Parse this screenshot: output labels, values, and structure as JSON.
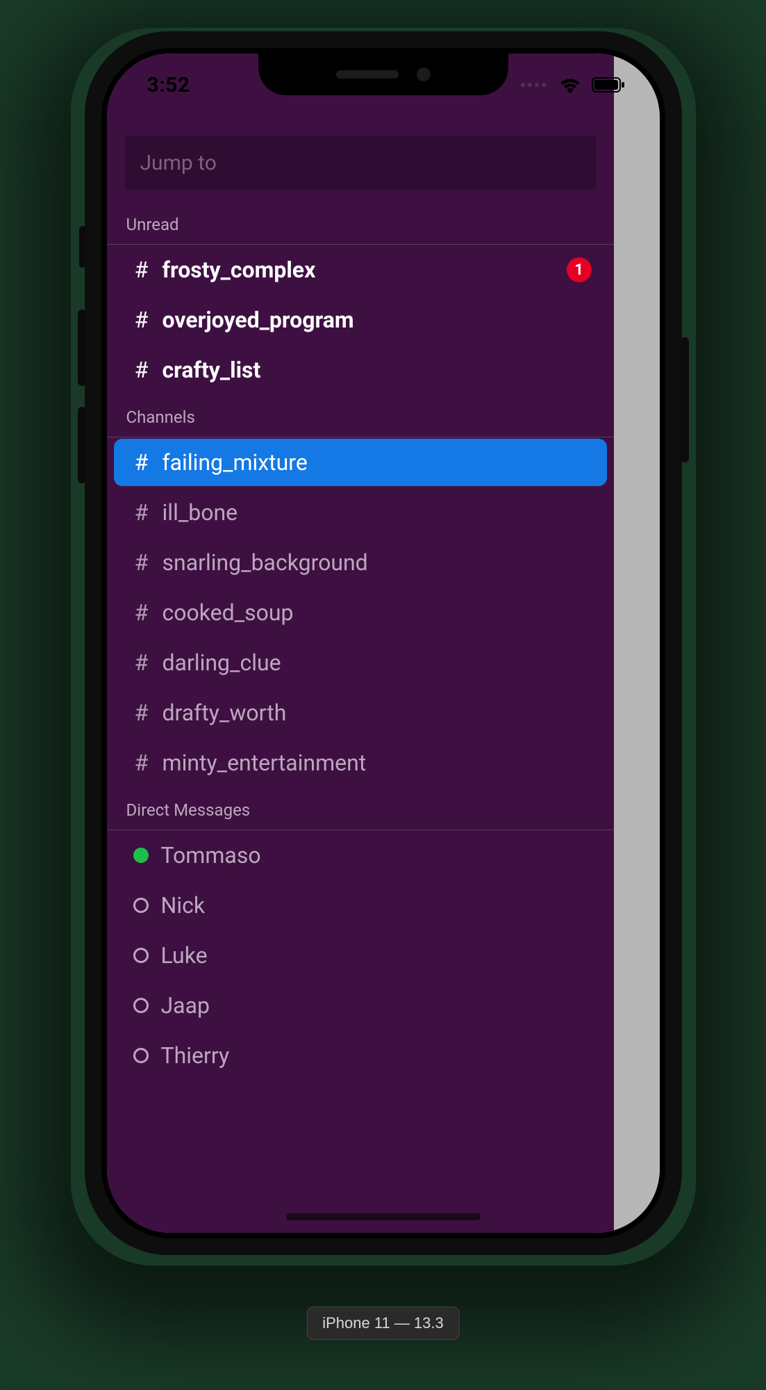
{
  "device_label": "iPhone 11 — 13.3",
  "status": {
    "time": "3:52"
  },
  "search": {
    "placeholder": "Jump to"
  },
  "sections": {
    "unread": {
      "title": "Unread",
      "items": [
        {
          "name": "frosty_complex",
          "badge": "1"
        },
        {
          "name": "overjoyed_program"
        },
        {
          "name": "crafty_list"
        }
      ]
    },
    "channels": {
      "title": "Channels",
      "items": [
        {
          "name": "failing_mixture",
          "selected": true
        },
        {
          "name": "ill_bone"
        },
        {
          "name": "snarling_background"
        },
        {
          "name": "cooked_soup"
        },
        {
          "name": "darling_clue"
        },
        {
          "name": "drafty_worth"
        },
        {
          "name": "minty_entertainment"
        }
      ]
    },
    "dms": {
      "title": "Direct Messages",
      "items": [
        {
          "name": "Tommaso",
          "online": true
        },
        {
          "name": "Nick",
          "online": false
        },
        {
          "name": "Luke",
          "online": false
        },
        {
          "name": "Jaap",
          "online": false
        },
        {
          "name": "Thierry",
          "online": false
        }
      ]
    }
  }
}
